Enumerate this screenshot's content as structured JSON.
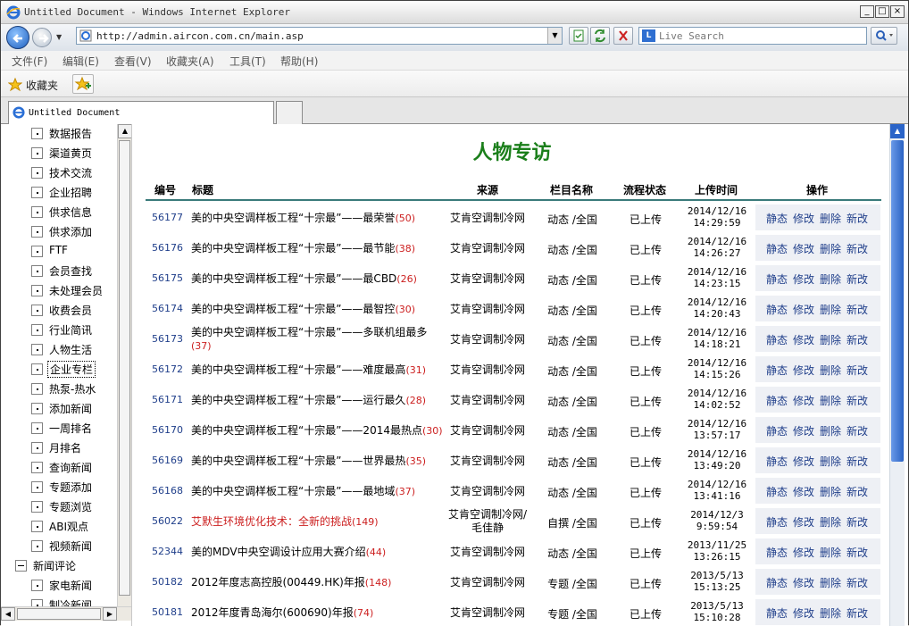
{
  "window": {
    "title": "Untitled Document - Windows Internet Explorer",
    "buttons": [
      "_",
      "□",
      "×"
    ]
  },
  "address": {
    "url": "http://admin.aircon.com.cn/main.asp",
    "search_placeholder": "Live Search"
  },
  "menu": [
    "文件(F)",
    "编辑(E)",
    "查看(V)",
    "收藏夹(A)",
    "工具(T)",
    "帮助(H)"
  ],
  "favorites": {
    "label": "收藏夹"
  },
  "tab": {
    "title": "Untitled Document"
  },
  "sidebar": {
    "items": [
      {
        "label": "数据报告"
      },
      {
        "label": "渠道黄页"
      },
      {
        "label": "技术交流"
      },
      {
        "label": "企业招聘"
      },
      {
        "label": "供求信息"
      },
      {
        "label": "供求添加"
      },
      {
        "label": "FTF"
      },
      {
        "label": "会员查找"
      },
      {
        "label": "未处理会员"
      },
      {
        "label": "收费会员"
      },
      {
        "label": "行业简讯"
      },
      {
        "label": "人物生活"
      },
      {
        "label": "企业专栏"
      },
      {
        "label": "热泵-热水"
      },
      {
        "label": "添加新闻"
      },
      {
        "label": "一周排名"
      },
      {
        "label": "月排名"
      },
      {
        "label": "查询新闻"
      },
      {
        "label": "专题添加"
      },
      {
        "label": "专题浏览"
      },
      {
        "label": "ABI观点"
      },
      {
        "label": "视频新闻"
      },
      {
        "label": "新闻评论"
      },
      {
        "label": "家电新闻"
      },
      {
        "label": "制冷新闻"
      }
    ]
  },
  "main": {
    "title": "人物专访",
    "headers": {
      "id": "编号",
      "title": "标题",
      "source": "来源",
      "column": "栏目名称",
      "status": "流程状态",
      "time": "上传时间",
      "ops": "操作"
    },
    "ops_labels": {
      "static": "静态",
      "edit": "修改",
      "delete": "删除",
      "newedit": "新改"
    },
    "rows": [
      {
        "id": "56177",
        "title": "美的中央空调样板工程“十宗最”——最荣誉",
        "count": "(50)",
        "source": "艾肯空调制冷网",
        "column": "动态 /全国",
        "status": "已上传",
        "date": "2014/12/16",
        "time": "14:29:59"
      },
      {
        "id": "56176",
        "title": "美的中央空调样板工程“十宗最”——最节能",
        "count": "(38)",
        "source": "艾肯空调制冷网",
        "column": "动态 /全国",
        "status": "已上传",
        "date": "2014/12/16",
        "time": "14:26:27"
      },
      {
        "id": "56175",
        "title": "美的中央空调样板工程“十宗最”——最CBD",
        "count": "(26)",
        "source": "艾肯空调制冷网",
        "column": "动态 /全国",
        "status": "已上传",
        "date": "2014/12/16",
        "time": "14:23:15"
      },
      {
        "id": "56174",
        "title": "美的中央空调样板工程“十宗最”——最智控",
        "count": "(30)",
        "source": "艾肯空调制冷网",
        "column": "动态 /全国",
        "status": "已上传",
        "date": "2014/12/16",
        "time": "14:20:43"
      },
      {
        "id": "56173",
        "title": "美的中央空调样板工程“十宗最”——多联机组最多",
        "count": "(37)",
        "source": "艾肯空调制冷网",
        "column": "动态 /全国",
        "status": "已上传",
        "date": "2014/12/16",
        "time": "14:18:21"
      },
      {
        "id": "56172",
        "title": "美的中央空调样板工程“十宗最”——难度最高",
        "count": "(31)",
        "source": "艾肯空调制冷网",
        "column": "动态 /全国",
        "status": "已上传",
        "date": "2014/12/16",
        "time": "14:15:26"
      },
      {
        "id": "56171",
        "title": "美的中央空调样板工程“十宗最”——运行最久",
        "count": "(28)",
        "source": "艾肯空调制冷网",
        "column": "动态 /全国",
        "status": "已上传",
        "date": "2014/12/16",
        "time": "14:02:52"
      },
      {
        "id": "56170",
        "title": "美的中央空调样板工程“十宗最”——2014最热点",
        "count": "(30)",
        "source": "艾肯空调制冷网",
        "column": "动态 /全国",
        "status": "已上传",
        "date": "2014/12/16",
        "time": "13:57:17"
      },
      {
        "id": "56169",
        "title": "美的中央空调样板工程“十宗最”——世界最热",
        "count": "(35)",
        "source": "艾肯空调制冷网",
        "column": "动态 /全国",
        "status": "已上传",
        "date": "2014/12/16",
        "time": "13:49:20"
      },
      {
        "id": "56168",
        "title": "美的中央空调样板工程“十宗最”——最地域",
        "count": "(37)",
        "source": "艾肯空调制冷网",
        "column": "动态 /全国",
        "status": "已上传",
        "date": "2014/12/16",
        "time": "13:41:16"
      },
      {
        "id": "56022",
        "title": "艾默生环境优化技术：全新的挑战",
        "count": "(149)",
        "source": "艾肯空调制冷网/毛佳静",
        "column": "自撰 /全国",
        "status": "已上传",
        "date": "2014/12/3",
        "time": "9:59:54",
        "red": true
      },
      {
        "id": "52344",
        "title": "美的MDV中央空调设计应用大赛介绍",
        "count": "(44)",
        "source": "艾肯空调制冷网",
        "column": "动态 /全国",
        "status": "已上传",
        "date": "2013/11/25",
        "time": "13:26:15"
      },
      {
        "id": "50182",
        "title": "2012年度志高控股(00449.HK)年报",
        "count": "(148)",
        "source": "艾肯空调制冷网",
        "column": "专题 /全国",
        "status": "已上传",
        "date": "2013/5/13",
        "time": "15:13:25"
      },
      {
        "id": "50181",
        "title": "2012年度青岛海尔(600690)年报",
        "count": "(74)",
        "source": "艾肯空调制冷网",
        "column": "专题 /全国",
        "status": "已上传",
        "date": "2013/5/13",
        "time": "15:10:28"
      }
    ]
  }
}
